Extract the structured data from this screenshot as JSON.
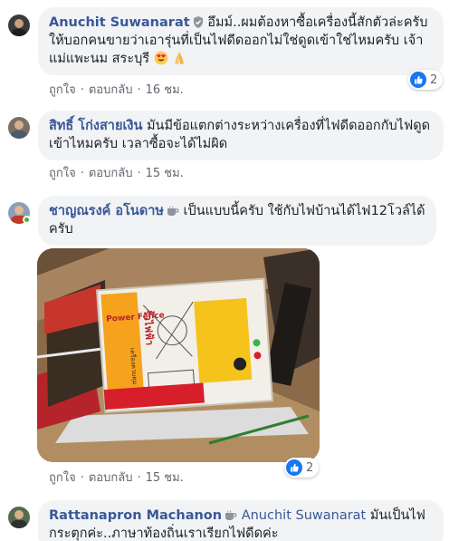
{
  "comments": [
    {
      "author": "Anuchit Suwanarat",
      "text": "อึมม์..ผมต้องหาซื้อเครื่องนี้สักตัวล่ะครับ ให้บอกคนขายว่าเอารุ่นที่เป็นไฟดีดออกไม่ใช่ดูดเข้าใช่ไหมครับ เจ้าแม่แพะนม สระบุรี",
      "like": "ถูกใจ",
      "reply": "ตอบกลับ",
      "time": "16 ชม.",
      "reactions": "2"
    },
    {
      "author": "สิทธิ์ โก่งสายเงิน",
      "text": "มันมีข้อแตกต่างระหว่างเครื่องที่ไฟดีดออกกับไฟดูดเข้าไหมครับ เวลาซื้อจะได้ไม่ผิด",
      "like": "ถูกใจ",
      "reply": "ตอบกลับ",
      "time": "15 ชม."
    },
    {
      "author": "ชาญณรงค์ อโนดาษ",
      "text": "เป็นแบบนี้ครับ ใช้กับไฟบ้านได้ไฟ12โวล์ได้ครับ",
      "like": "ถูกใจ",
      "reply": "ตอบกลับ",
      "time": "15 ชม.",
      "reactions": "2",
      "photo_text": {
        "brand": "Power Fence",
        "thai_label": "รั้วไฟฟ้า",
        "side": "เครื่องควบคุม"
      }
    },
    {
      "author": "Rattanapron Machanon",
      "mention": "Anuchit Suwanarat",
      "text": "มันเป็นไฟกระตุกค่ะ..ภาษาท้องถิ่นเราเรียกไฟดีดค่ะ"
    }
  ],
  "colors": {
    "link": "#385898",
    "bubble": "#f2f3f5",
    "meta": "#606770",
    "like_blue": "#1877f2",
    "online": "#42b72a"
  },
  "icons": [
    "verified-shield-icon",
    "coffee-cup-icon",
    "heart-eyes-emoji-icon",
    "praying-hands-emoji-icon",
    "like-thumb-icon"
  ]
}
